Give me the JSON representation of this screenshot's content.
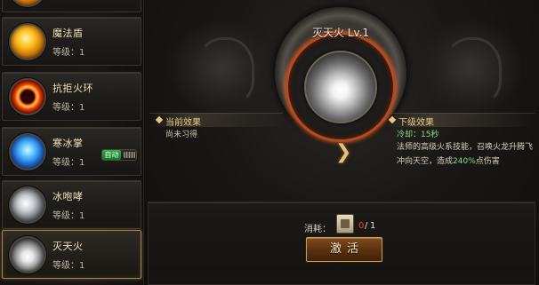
{
  "skills": [
    {
      "name": "",
      "level_label": "",
      "icon": "fire-orb-icon"
    },
    {
      "name": "魔法盾",
      "level_label": "等级：1",
      "icon": "magic-shield-icon"
    },
    {
      "name": "抗拒火环",
      "level_label": "等级：1",
      "icon": "fire-ring-icon"
    },
    {
      "name": "寒冰掌",
      "level_label": "等级：1",
      "icon": "ice-palm-icon",
      "auto_label": "自动",
      "auto_enabled": true
    },
    {
      "name": "冰咆哮",
      "level_label": "等级：1",
      "icon": "ice-roar-icon"
    },
    {
      "name": "灭天火",
      "level_label": "等级：1",
      "icon": "heaven-fire-icon",
      "selected": true
    }
  ],
  "detail": {
    "title": "灭天火 Lv.1",
    "current_header": "当前效果",
    "current_text": "尚未习得",
    "next_header": "下级效果",
    "cooldown": "冷却：15秒",
    "desc_part1": "法师的高级火系技能，召唤火龙升腾飞冲向天空，造成",
    "desc_pct": "240%",
    "desc_part2": "点伤害"
  },
  "cost": {
    "label": "消耗：",
    "have": "0",
    "separator": "/",
    "need": "1"
  },
  "activate_label": "激活",
  "colors": {
    "accent_gold": "#e9cf86",
    "highlight_green": "#7fe07a",
    "warning_red": "#ff3b2b",
    "fire_ring": "#b84a1c"
  }
}
